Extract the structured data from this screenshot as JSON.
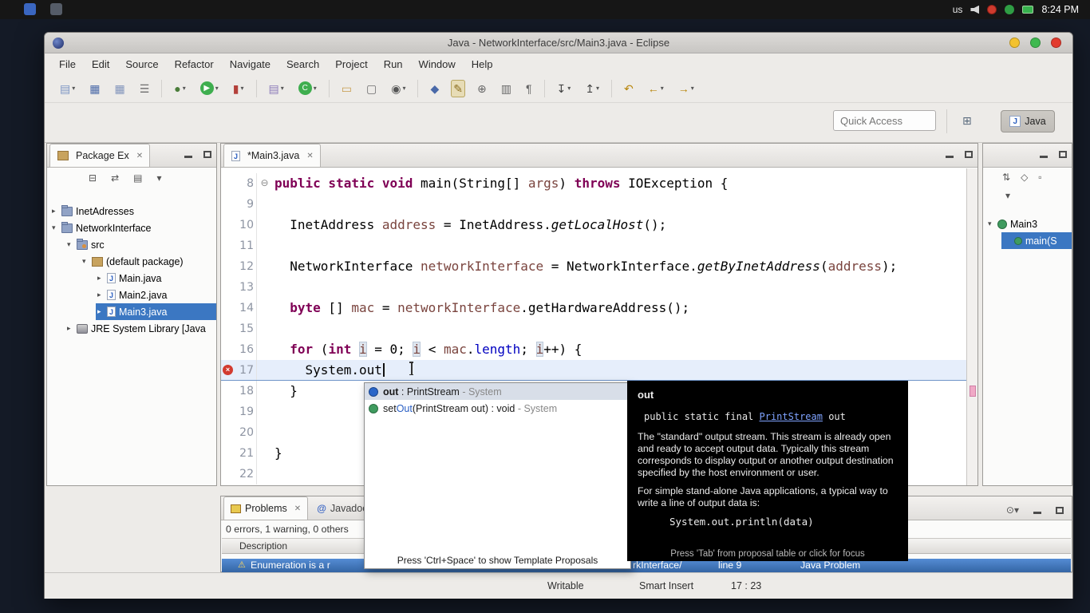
{
  "system_bar": {
    "keyboard": "us",
    "clock": "8:24 PM"
  },
  "window": {
    "title": "Java - NetworkInterface/src/Main3.java - Eclipse",
    "menus": [
      "File",
      "Edit",
      "Source",
      "Refactor",
      "Navigate",
      "Search",
      "Project",
      "Run",
      "Window",
      "Help"
    ],
    "quick_access": "Quick Access",
    "perspective": "Java"
  },
  "icons": {
    "close": "✕",
    "chevron_down": "▾",
    "chevron_right": "▸",
    "fold_collapse": "⊖",
    "error": "×",
    "warning": "⚠",
    "at": "@",
    "j": "J",
    "open_perspective": "⊞"
  },
  "toolbar": {
    "icons": [
      {
        "name": "new-button",
        "glyph": "▤",
        "color": "#7c95c4",
        "dd": true
      },
      {
        "name": "save-button",
        "glyph": "▦",
        "color": "#4a69a8"
      },
      {
        "name": "save-all-button",
        "glyph": "▦",
        "color": "#8194bb"
      },
      {
        "name": "print-button",
        "glyph": "☰",
        "color": "#6e6e6e"
      },
      {
        "sep": true
      },
      {
        "name": "debug-button",
        "glyph": "●",
        "color": "#4a7d3a",
        "dd": true
      },
      {
        "name": "run-button",
        "glyph": "▶",
        "chip": "#3fae4f",
        "dd": true
      },
      {
        "name": "coverage-button",
        "glyph": "▮",
        "color": "#b3403a",
        "dd": true
      },
      {
        "sep": true
      },
      {
        "name": "new-java-project-button",
        "glyph": "▤",
        "color": "#8a7ab8",
        "dd": true
      },
      {
        "name": "new-class-button",
        "glyph": "C",
        "chip": "#3fae4f",
        "dd": true
      },
      {
        "sep": true
      },
      {
        "name": "open-folder-button",
        "glyph": "▭",
        "color": "#c79b4b"
      },
      {
        "name": "open-type-button",
        "glyph": "▢",
        "color": "#6e6e6e"
      },
      {
        "name": "search-button",
        "glyph": "◉",
        "color": "#555555",
        "dd": true
      },
      {
        "sep": true
      },
      {
        "name": "external-tools-button",
        "glyph": "◆",
        "color": "#4a69a8"
      },
      {
        "name": "mark-occurrences-button",
        "glyph": "✎",
        "color": "#8a6d1f",
        "active": true
      },
      {
        "name": "pin-editor-button",
        "glyph": "⊕",
        "color": "#666666"
      },
      {
        "name": "show-annotations-button",
        "glyph": "▥",
        "color": "#666666"
      },
      {
        "name": "whitespace-button",
        "glyph": "¶",
        "color": "#666666"
      },
      {
        "sep": true
      },
      {
        "name": "next-annotation-button",
        "glyph": "↧",
        "color": "#444444",
        "dd": true
      },
      {
        "name": "prev-annotation-button",
        "glyph": "↥",
        "color": "#444444",
        "dd": true
      },
      {
        "sep": true
      },
      {
        "name": "last-edit-location-button",
        "glyph": "↶",
        "color": "#b8860b"
      },
      {
        "name": "back-button",
        "glyph": "←",
        "color": "#b8860b",
        "dd": true
      },
      {
        "name": "forward-button",
        "glyph": "→",
        "color": "#b8860b",
        "dd": true
      }
    ]
  },
  "package_explorer": {
    "title": "Package Ex",
    "toolbar": [
      {
        "name": "collapse-all-button",
        "glyph": "⊟"
      },
      {
        "name": "link-editor-button",
        "glyph": "⇄"
      },
      {
        "name": "filters-button",
        "glyph": "▤"
      },
      {
        "name": "view-menu-button",
        "glyph": "▾"
      }
    ],
    "items": [
      {
        "label": "InetAdresses",
        "indent": 0,
        "arrow": "right",
        "icon": "project"
      },
      {
        "label": "NetworkInterface",
        "indent": 0,
        "arrow": "down",
        "icon": "project"
      },
      {
        "label": "src",
        "indent": 1,
        "arrow": "down",
        "icon": "src"
      },
      {
        "label": "(default package)",
        "indent": 2,
        "arrow": "down",
        "icon": "package"
      },
      {
        "label": "Main.java",
        "indent": 3,
        "arrow": "right",
        "icon": "jfile"
      },
      {
        "label": "Main2.java",
        "indent": 3,
        "arrow": "right",
        "icon": "jfile"
      },
      {
        "label": "Main3.java",
        "indent": 3,
        "arrow": "right",
        "icon": "jfile",
        "selected": true
      },
      {
        "label": "JRE System Library [Java",
        "indent": 1,
        "arrow": "right",
        "icon": "library"
      }
    ]
  },
  "editor": {
    "tab": "*Main3.java",
    "lines": [
      {
        "num": "8",
        "fold": true,
        "segs": [
          {
            "t": "public static void",
            "c": "k"
          },
          {
            "t": " main(String[] "
          },
          {
            "t": "args",
            "c": "v"
          },
          {
            "t": ") "
          },
          {
            "t": "throws",
            "c": "k"
          },
          {
            "t": " IOException {"
          }
        ]
      },
      {
        "num": "9",
        "segs": []
      },
      {
        "num": "10",
        "segs": [
          {
            "t": "  InetAddress "
          },
          {
            "t": "address",
            "c": "v"
          },
          {
            "t": " = InetAddress."
          },
          {
            "t": "getLocalHost",
            "c": "m"
          },
          {
            "t": "();"
          }
        ]
      },
      {
        "num": "11",
        "segs": []
      },
      {
        "num": "12",
        "segs": [
          {
            "t": "  NetworkInterface "
          },
          {
            "t": "networkInterface",
            "c": "v"
          },
          {
            "t": " = NetworkInterface."
          },
          {
            "t": "getByInetAddress",
            "c": "m"
          },
          {
            "t": "("
          },
          {
            "t": "address",
            "c": "v"
          },
          {
            "t": ");"
          }
        ]
      },
      {
        "num": "13",
        "segs": []
      },
      {
        "num": "14",
        "segs": [
          {
            "t": "  "
          },
          {
            "t": "byte",
            "c": "k"
          },
          {
            "t": " [] "
          },
          {
            "t": "mac",
            "c": "v"
          },
          {
            "t": " = "
          },
          {
            "t": "networkInterface",
            "c": "v"
          },
          {
            "t": ".getHardwareAddress();"
          }
        ]
      },
      {
        "num": "15",
        "segs": []
      },
      {
        "num": "16",
        "segs": [
          {
            "t": "  "
          },
          {
            "t": "for",
            "c": "k"
          },
          {
            "t": " ("
          },
          {
            "t": "int",
            "c": "k"
          },
          {
            "t": " "
          },
          {
            "t": "i",
            "c": "o"
          },
          {
            "t": " = 0; "
          },
          {
            "t": "i",
            "c": "o"
          },
          {
            "t": " < "
          },
          {
            "t": "mac",
            "c": "v"
          },
          {
            "t": "."
          },
          {
            "t": "length",
            "c": "f"
          },
          {
            "t": "; "
          },
          {
            "t": "i",
            "c": "o"
          },
          {
            "t": "++) {"
          }
        ]
      },
      {
        "num": "17",
        "current": true,
        "error": true,
        "caret": true,
        "segs": [
          {
            "t": "    System.out"
          }
        ]
      },
      {
        "num": "18",
        "segs": [
          {
            "t": "  }"
          }
        ]
      },
      {
        "num": "19",
        "segs": []
      },
      {
        "num": "20",
        "segs": []
      },
      {
        "num": "21",
        "segs": [
          {
            "t": "}"
          }
        ]
      },
      {
        "num": "22",
        "segs": []
      }
    ]
  },
  "outline": {
    "toolbar": [
      {
        "name": "sort-button",
        "glyph": "⇅"
      },
      {
        "name": "hide-fields-button",
        "glyph": "◇"
      },
      {
        "name": "hide-static-button",
        "glyph": "▫"
      }
    ],
    "items": [
      {
        "label": "Main3",
        "indent": 0,
        "arrow": "down",
        "icon": "class"
      },
      {
        "label": "main(S",
        "indent": 1,
        "icon": "method",
        "selected": true
      }
    ]
  },
  "completion": {
    "items": [
      {
        "icon": "field",
        "selected": true,
        "segs": [
          {
            "t": "out",
            "c": "bm"
          },
          {
            "t": " : PrintStream"
          },
          {
            "t": " - System",
            "c": "q"
          }
        ]
      },
      {
        "icon": "method",
        "segs": [
          {
            "t": "set"
          },
          {
            "t": "Out",
            "c": "bl"
          },
          {
            "t": "(PrintStream out) : void"
          },
          {
            "t": " - System",
            "c": "q"
          }
        ]
      }
    ],
    "footer": "Press 'Ctrl+Space' to show Template Proposals"
  },
  "javadoc": {
    "title": "out",
    "sig_pre": "public static final ",
    "sig_link": "PrintStream",
    "sig_post": " out",
    "paras": [
      "The \"standard\" output stream. This stream is already open and ready to accept output data. Typically this stream corresponds to display output or another output destination specified by the host environment or user.",
      "For simple stand-alone Java applications, a typical way to write a line of output data is:"
    ],
    "code": "System.out.println(data)",
    "footer": "Press 'Tab' from proposal table or click for focus"
  },
  "problems": {
    "tab1": "Problems",
    "tab2": "Javadoc",
    "summary": "0 errors, 1 warning, 0 others",
    "col_description": "Description",
    "row": {
      "description": "Enumeration is a r",
      "resource": "rkInterface/",
      "location": "line 9",
      "type": "Java Problem"
    },
    "toolbar": [
      {
        "name": "view-menu-button",
        "glyph": "⊙"
      },
      {
        "name": "chevron-down-button",
        "glyph": "▾"
      }
    ]
  },
  "status_bar": {
    "writable": "Writable",
    "insert_mode": "Smart Insert",
    "position": "17 : 23"
  }
}
